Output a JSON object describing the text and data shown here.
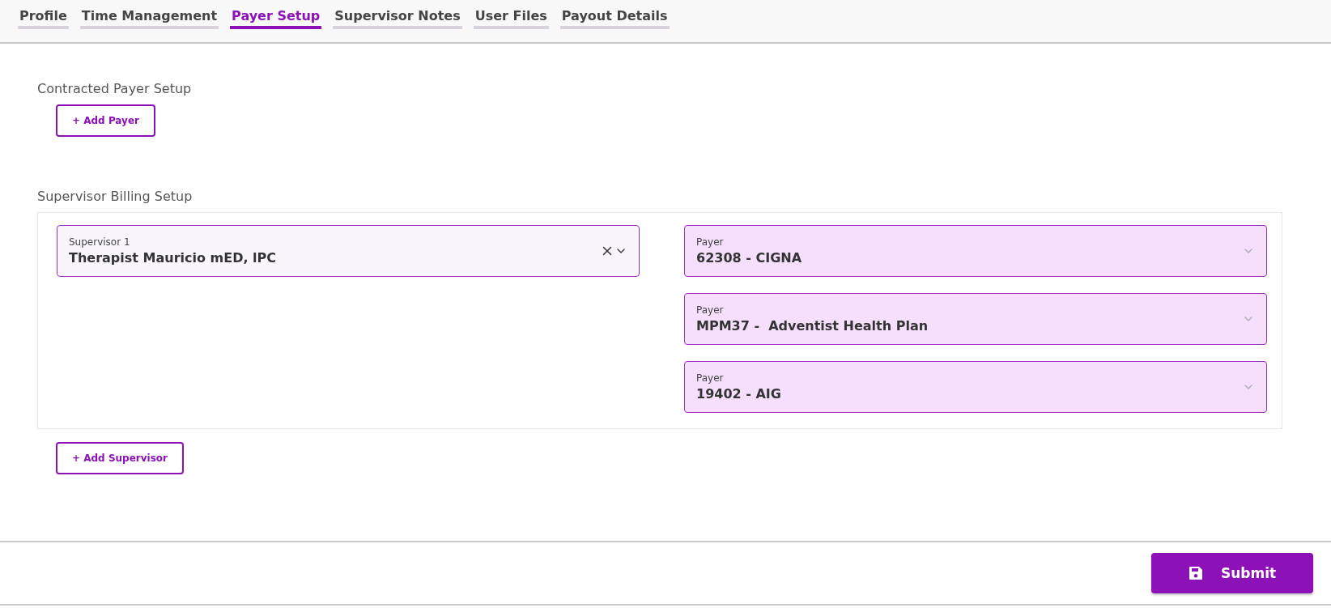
{
  "tabs": [
    {
      "label": "Profile",
      "selected": false
    },
    {
      "label": "Time Management",
      "selected": false
    },
    {
      "label": "Payer Setup",
      "selected": true
    },
    {
      "label": "Supervisor Notes",
      "selected": false
    },
    {
      "label": "User Files",
      "selected": false
    },
    {
      "label": "Payout Details",
      "selected": false
    }
  ],
  "contracted_payer_setup": {
    "heading": "Contracted Payer Setup",
    "add_button": "+ Add Payer"
  },
  "supervisor_billing_setup": {
    "heading": "Supervisor Billing Setup",
    "supervisors": [
      {
        "label": "Supervisor 1",
        "value": "Therapist Mauricio mED, lPC",
        "payers": [
          {
            "label": "Payer",
            "value": "62308 - CIGNA"
          },
          {
            "label": "Payer",
            "value": "MPM37 -  Adventist Health Plan"
          },
          {
            "label": "Payer",
            "value": "19402 - AIG"
          }
        ]
      }
    ],
    "add_button": "+ Add Supervisor"
  },
  "footer": {
    "submit_button": "Submit"
  }
}
